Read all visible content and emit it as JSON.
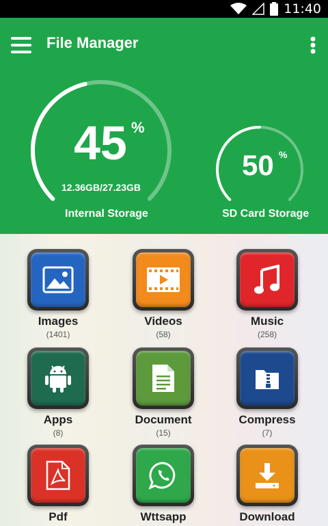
{
  "status_bar": {
    "time": "11:40"
  },
  "toolbar": {
    "title": "File Manager"
  },
  "internal_storage": {
    "percent": "45",
    "percent_value": 45,
    "percent_sign": "%",
    "usage": "12.36GB/27.23GB",
    "label": "Internal Storage"
  },
  "sd_storage": {
    "percent": "50",
    "percent_value": 50,
    "percent_sign": "%",
    "label": "SD Card Storage"
  },
  "colors": {
    "header": "#1fa64a",
    "blue": "#2565c2",
    "orange": "#f28a1c",
    "red": "#e0262a",
    "dark_green": "#1e6b50",
    "olive": "#5c9a3c",
    "navy": "#1d4a8e",
    "pdf_red": "#db3228",
    "whatsapp_green": "#2ea84a",
    "amber": "#e99118"
  },
  "categories": [
    {
      "label": "Images",
      "count": "(1401)",
      "icon": "image-icon"
    },
    {
      "label": "Videos",
      "count": "(58)",
      "icon": "video-icon"
    },
    {
      "label": "Music",
      "count": "(258)",
      "icon": "music-note-icon"
    },
    {
      "label": "Apps",
      "count": "(8)",
      "icon": "android-icon"
    },
    {
      "label": "Document",
      "count": "(15)",
      "icon": "document-icon"
    },
    {
      "label": "Compress",
      "count": "(7)",
      "icon": "zip-folder-icon"
    },
    {
      "label": "Pdf",
      "icon": "pdf-icon"
    },
    {
      "label": "Wttsapp",
      "icon": "whatsapp-icon"
    },
    {
      "label": "Download",
      "icon": "download-icon"
    }
  ]
}
